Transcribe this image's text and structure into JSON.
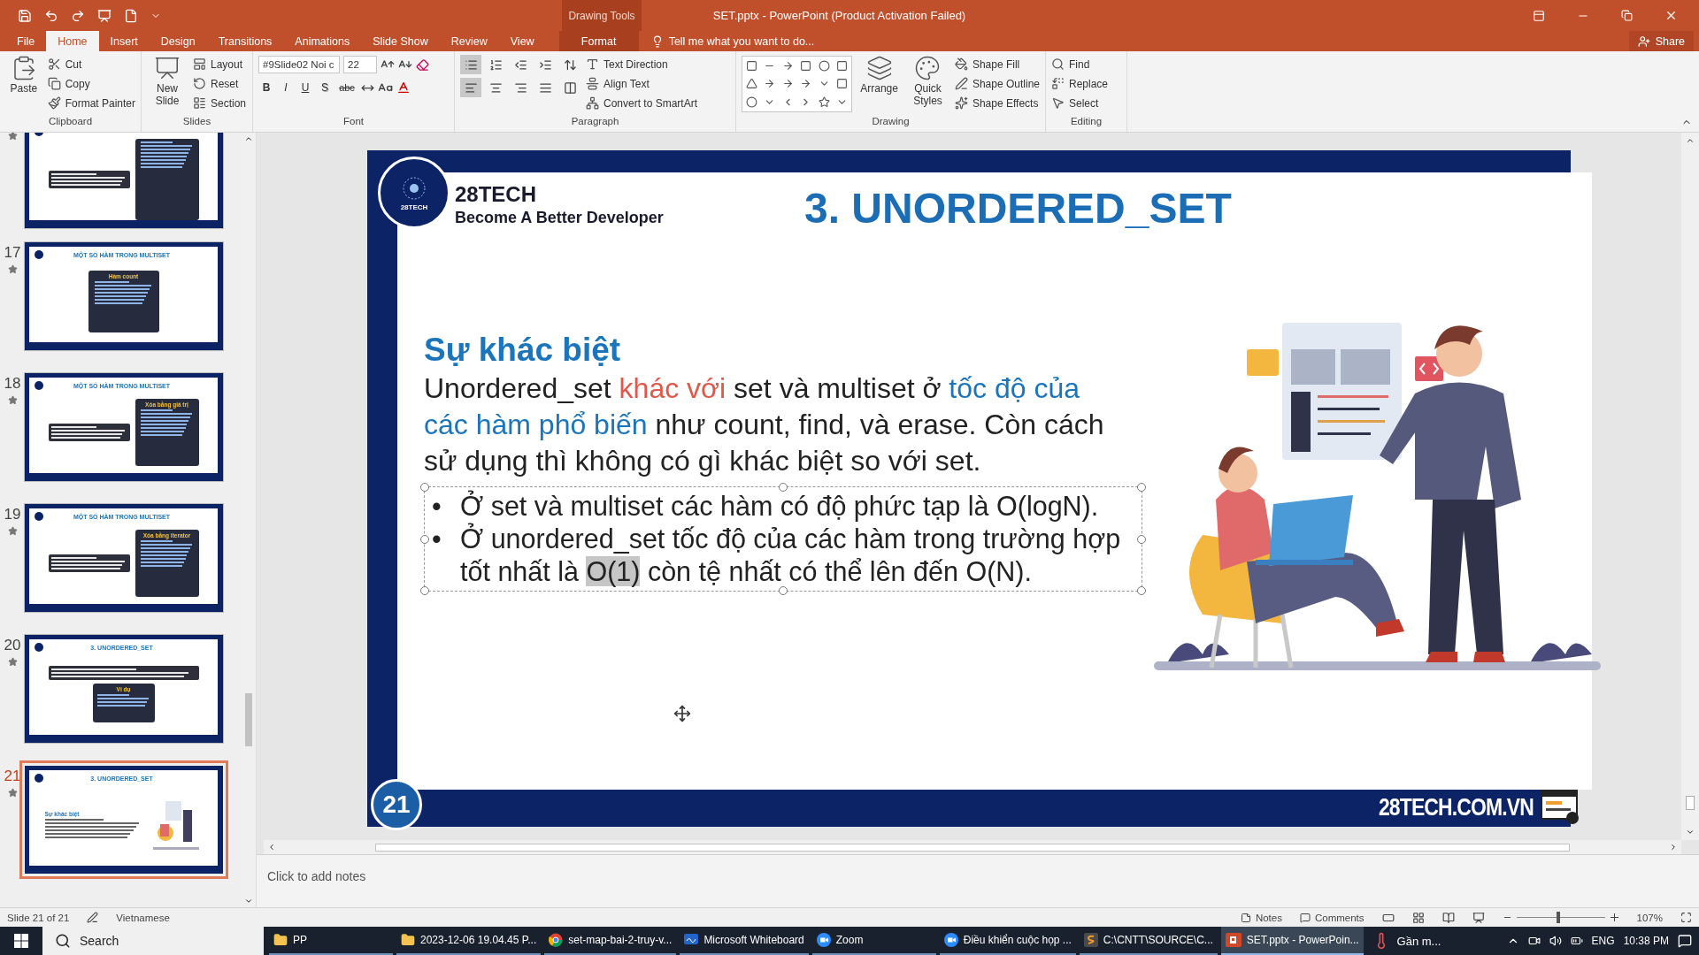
{
  "title_bar": {
    "title": "SET.pptx - PowerPoint (Product Activation Failed)",
    "context_label": "Drawing Tools"
  },
  "tabs": [
    {
      "label": "File",
      "selected": false,
      "kind": "file"
    },
    {
      "label": "Home",
      "selected": true,
      "kind": "normal"
    },
    {
      "label": "Insert",
      "selected": false,
      "kind": "normal"
    },
    {
      "label": "Design",
      "selected": false,
      "kind": "normal"
    },
    {
      "label": "Transitions",
      "selected": false,
      "kind": "normal"
    },
    {
      "label": "Animations",
      "selected": false,
      "kind": "normal"
    },
    {
      "label": "Slide Show",
      "selected": false,
      "kind": "normal"
    },
    {
      "label": "Review",
      "selected": false,
      "kind": "normal"
    },
    {
      "label": "View",
      "selected": false,
      "kind": "normal"
    },
    {
      "label": "Format",
      "selected": false,
      "kind": "contextual"
    }
  ],
  "tell_me": "Tell me what you want to do...",
  "share": "Share",
  "ribbon": [
    {
      "kind": "clipboard",
      "label": "Clipboard",
      "large": [
        "Paste"
      ],
      "small": [
        "Cut",
        "Copy",
        "Format Painter"
      ]
    },
    {
      "kind": "slides",
      "label": "Slides",
      "large": [
        "New Slide"
      ],
      "small": [
        "Layout",
        "Reset",
        "Section"
      ]
    },
    {
      "kind": "font",
      "label": "Font",
      "font_name": "#9Slide02 Noi c",
      "font_size": "22",
      "style_buttons": [
        "B",
        "I",
        "U",
        "S",
        "abc"
      ]
    },
    {
      "kind": "paragraph",
      "label": "Paragraph",
      "toggles": [
        {
          "selected": true
        },
        {
          "selected": false
        },
        {
          "selected": false
        },
        {
          "selected": false
        },
        {
          "selected": false
        },
        {
          "selected": true
        },
        {
          "selected": false
        },
        {
          "selected": false
        },
        {
          "selected": false
        },
        {
          "selected": false
        }
      ],
      "small": [
        "Text Direction",
        "Align Text",
        "Convert to SmartArt"
      ]
    },
    {
      "kind": "drawing",
      "label": "Drawing",
      "large": [
        "Arrange",
        "Quick Styles"
      ],
      "small": [
        "Shape Fill",
        "Shape Outline",
        "Shape Effects"
      ]
    },
    {
      "kind": "editing",
      "label": "Editing",
      "small": [
        "Find",
        "Replace",
        "Select"
      ]
    }
  ],
  "thumbnails": [
    {
      "kind": "callout_code",
      "selected": false
    },
    {
      "kind": "code",
      "number": "17",
      "title": "MỘT SỐ HÀM TRONG MULTISET",
      "subtitle": "Hàm count",
      "selected": false
    },
    {
      "kind": "callout_code",
      "number": "18",
      "title": "MỘT SỐ HÀM TRONG MULTISET",
      "subtitle": "Xóa bằng giá trị",
      "selected": false
    },
    {
      "kind": "callout_code",
      "number": "19",
      "title": "MỘT SỐ HÀM TRONG MULTISET",
      "subtitle": "Xóa bằng iterator",
      "selected": false
    },
    {
      "kind": "banner_code",
      "number": "20",
      "title": "3. UNORDERED_SET",
      "subtitle": "Ví dụ",
      "selected": false
    },
    {
      "kind": "text_art",
      "number": "21",
      "title": "3. UNORDERED_SET",
      "subtitle": "Sự khác biệt",
      "selected": true
    }
  ],
  "slide": {
    "logo_text": "28TECH",
    "brand": "28TECH",
    "tagline": "Become A Better Developer",
    "title": "3. UNORDERED_SET",
    "heading": "Sự khác biệt",
    "paragraph": [
      {
        "text": "Unordered_set ",
        "color": "#222222"
      },
      {
        "text": "khác với",
        "color": "#e0584a"
      },
      {
        "text": " set và multiset ở ",
        "color": "#222222"
      },
      {
        "text": "tốc độ của các hàm phổ biến",
        "color": "#1b75bc"
      },
      {
        "text": " như count, find, và erase. Còn cách sử dụng thì không có gì khác biệt so với set.",
        "color": "#222222"
      }
    ],
    "bullets": [
      {
        "marker": "•",
        "segments": [
          {
            "text": "Ở set và multiset các hàm có độ phức tạp là O(logN).",
            "highlighted": false
          }
        ]
      },
      {
        "marker": "•",
        "segments": [
          {
            "text": "Ở unordered_set tốc độ của các hàm trong trường hợp tốt nhất là ",
            "highlighted": false
          },
          {
            "text": "O(1)",
            "highlighted": true
          },
          {
            "text": " còn tệ nhất có thể lên đến O(N).",
            "highlighted": false
          }
        ]
      }
    ],
    "page_number": "21",
    "footer": "28TECH.COM.VN"
  },
  "notes_placeholder": "Click to add notes",
  "status_bar": {
    "slide_info": "Slide 21 of 21",
    "language": "Vietnamese",
    "notes": "Notes",
    "comments": "Comments",
    "zoom": "107%",
    "zoom_slider": {
      "level": 0.45
    }
  },
  "taskbar": {
    "search": "Search",
    "apps": [
      {
        "label": "PP",
        "kind": "folder",
        "selected": false
      },
      {
        "label": "2023-12-06 19.04.45 P...",
        "kind": "folder",
        "selected": false
      },
      {
        "label": "set-map-bai-2-truy-v...",
        "kind": "browser",
        "selected": false
      },
      {
        "label": "Microsoft Whiteboard",
        "kind": "whiteboard",
        "selected": false
      },
      {
        "label": "Zoom",
        "kind": "zoom",
        "selected": false
      },
      {
        "label": "Điều khiển cuộc họp ...",
        "kind": "zoom",
        "selected": false
      },
      {
        "label": "C:\\CNTT\\SOURCE\\C...",
        "kind": "editor",
        "selected": false
      },
      {
        "label": "SET.pptx - PowerPoin...",
        "kind": "powerpoint",
        "selected": true
      }
    ],
    "weather": "Gần m...",
    "language": "ENG",
    "time": "10:38 PM"
  }
}
